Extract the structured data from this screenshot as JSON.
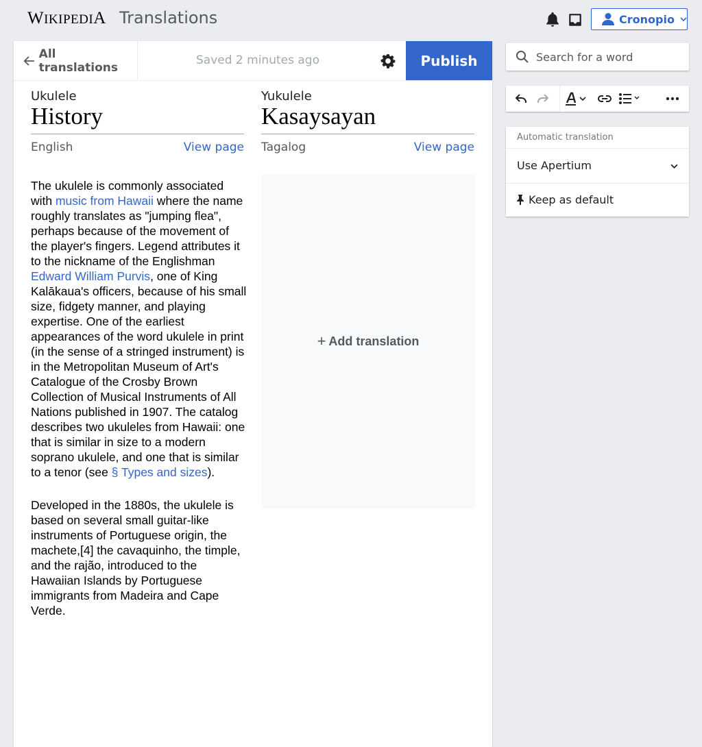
{
  "header": {
    "logo_first": "W",
    "logo_rest": "IKIPEDI",
    "logo_last": "A",
    "app_title": "Translations",
    "user_name": "Cronopio"
  },
  "toolbar": {
    "back_label": "All translations",
    "saved_status": "Saved 2 minutes ago",
    "publish_label": "Publish"
  },
  "source": {
    "subtitle": "Ukulele",
    "title": "History",
    "language": "English",
    "view_page": "View page"
  },
  "target": {
    "subtitle": "Yukulele",
    "title": "Kasaysayan",
    "language": "Tagalog",
    "view_page": "View page",
    "add_translation": "Add translation"
  },
  "article": {
    "p1_a": "The ukulele is commonly associated with ",
    "p1_link1": "music from Hawaii",
    "p1_b": " where the name roughly translates as \"jumping flea\", perhaps because of the movement of the player's fingers. Legend attributes it to the nickname of the Englishman ",
    "p1_link2": "Edward William Purvis",
    "p1_c": ", one of King Kalākaua's officers, because of his small size, fidgety manner, and playing expertise. One of the earliest appearances of the word ukulele in print (in the sense of a stringed instrument) is in the Metropolitan Museum of Art's Catalogue of the Crosby Brown Collection of Musical Instruments of All Nations published in 1907. The catalog describes two ukuleles from Hawaii: one that is similar in size to a modern soprano ukulele, and one that is similar to a tenor (see ",
    "p1_link3": "§ Types and sizes",
    "p1_d": ").",
    "p2": "Developed in the 1880s, the ukulele is based on several small guitar-like instruments of Portuguese origin, the machete,[4] the cavaquinho, the timple, and the rajão, introduced to the Hawaiian Islands by Portuguese immigrants from Madeira and Cape Verde."
  },
  "sidebar": {
    "search_placeholder": "Search for a word",
    "auto_heading": "Automatic translation",
    "auto_option": "Use Apertium",
    "keep_default": "Keep as default"
  },
  "colors": {
    "accent": "#3366cc",
    "page_bg": "#eaecf0",
    "muted_text": "#54595d"
  }
}
